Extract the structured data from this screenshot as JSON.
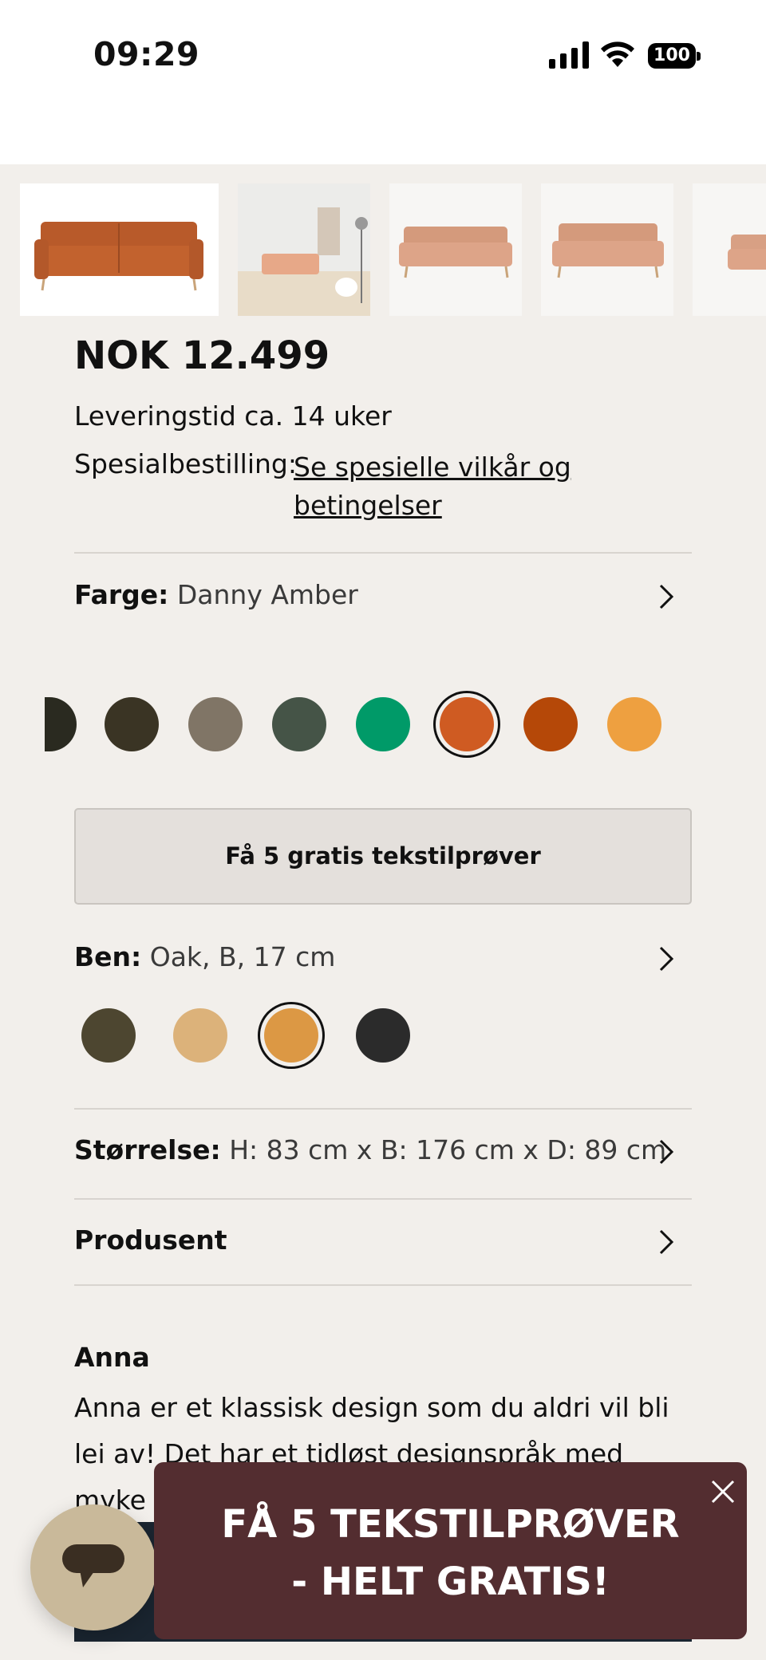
{
  "status": {
    "time": "09:29",
    "battery": "100"
  },
  "product": {
    "price": "NOK 12.499",
    "delivery": "Leveringstid ca. 14 uker",
    "special_label": "Spesialbestilling:",
    "special_link": "Se spesielle vilkår og betingelser"
  },
  "color": {
    "label": "Farge:",
    "value": "Danny Amber",
    "swatches": [
      "#2a2a20",
      "#3a3424",
      "#807566",
      "#455447",
      "#009a68",
      "#cf5b22",
      "#b54808",
      "#eea040"
    ],
    "selected_index": 5
  },
  "samples_button": "Få 5 gratis tekstilprøver",
  "legs": {
    "label": "Ben:",
    "value": "Oak, B, 17 cm",
    "swatches": [
      "#4d4630",
      "#dcb27a",
      "#dc9844",
      "#2b2b2b"
    ],
    "selected_index": 2
  },
  "size": {
    "label": "Størrelse:",
    "value": "H: 83 cm x B: 176 cm x D: 89 cm"
  },
  "manufacturer": {
    "label": "Produsent"
  },
  "description": {
    "title": "Anna",
    "text": "Anna er et klassisk design som du aldri vil bli lei av! Det har et tidløst designspråk med myke puter o"
  },
  "promo": {
    "line1": "FÅ 5 TEKSTILPRØVER",
    "line2": "- HELT GRATIS!"
  },
  "icons": [
    "signal-icon",
    "wifi-icon",
    "battery-icon",
    "chevron-right-icon",
    "chat-icon",
    "close-icon"
  ]
}
